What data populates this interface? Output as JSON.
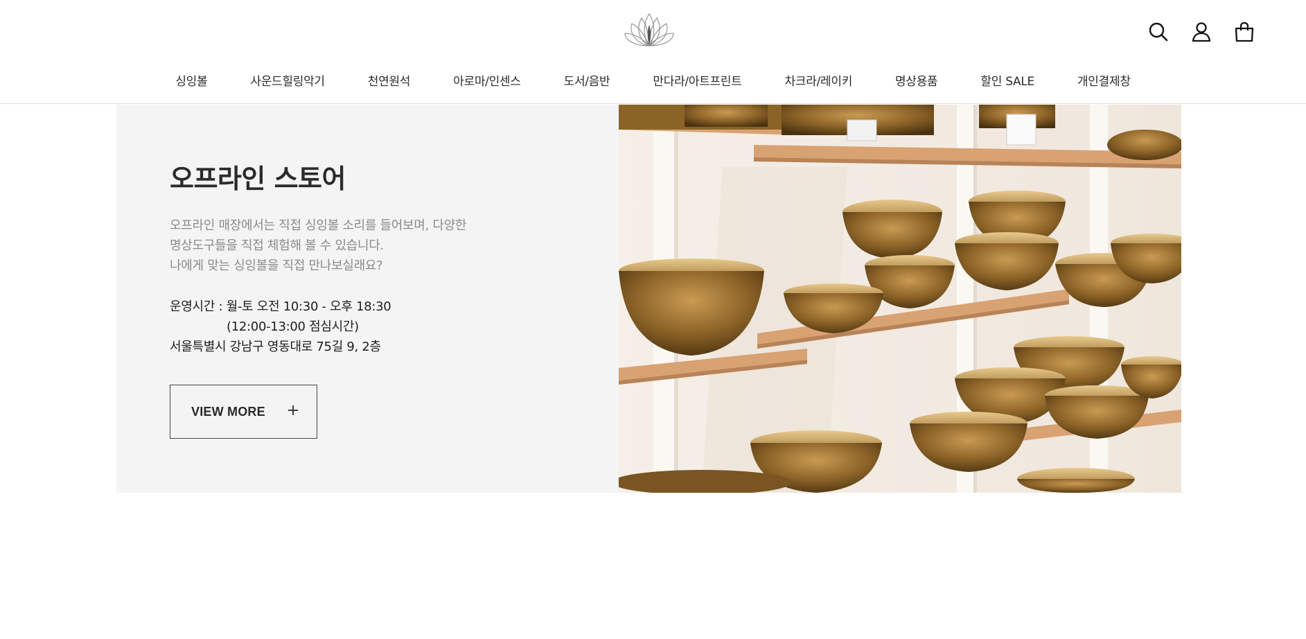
{
  "header": {
    "logo_name": "lotus-logo",
    "icons": [
      {
        "name": "search-icon"
      },
      {
        "name": "account-icon"
      },
      {
        "name": "cart-icon"
      }
    ]
  },
  "nav": {
    "items": [
      {
        "label": "싱잉볼"
      },
      {
        "label": "사운드힐링악기"
      },
      {
        "label": "천연원석"
      },
      {
        "label": "아로마/인센스"
      },
      {
        "label": "도서/음반"
      },
      {
        "label": "만다라/아트프린트"
      },
      {
        "label": "차크라/레이키"
      },
      {
        "label": "명상용품"
      },
      {
        "label": "할인 SALE"
      },
      {
        "label": "개인결제창"
      }
    ]
  },
  "store": {
    "title": "오프라인 스토어",
    "description": [
      "오프라인 매장에서는 직접 싱잉볼 소리를 들어보며, 다양한",
      "명상도구들을 직접 체험해 볼 수 있습니다.",
      "나에게 맞는 싱잉볼을 직접 만나보실래요?"
    ],
    "hours": "운영시간 : 월-토 오전 10:30 - 오후 18:30",
    "lunch": "(12:00-13:00 점심시간)",
    "address": "서울특별시 강남구 영동대로 75길 9, 2층",
    "button_label": "VIEW MORE",
    "button_icon": "plus-icon"
  },
  "colors": {
    "panel_bg": "#f4f4f4",
    "text_dark": "#2b2b2b",
    "text_muted": "#8a8a8a",
    "shelf_wood": "#d9a272",
    "bowl_brass": "#a87a3a"
  }
}
